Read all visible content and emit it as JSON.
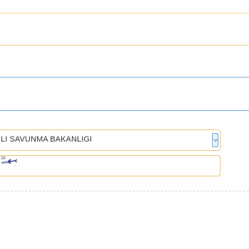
{
  "colors": {
    "rule_top": "#f5d9a0",
    "rule_mid": "#f3cd85",
    "rule_blue": "#7fb3e0",
    "rule_blue_2": "#6fa8dc",
    "field_border": "#f0c674",
    "arrow_border": "#6fa8dc"
  },
  "form": {
    "institution_select": {
      "value": "LI SAVUNMA BAKANLIGI"
    },
    "logo_field": {
      "icon": "aircraft-logo-icon",
      "logo_text": "38"
    }
  }
}
